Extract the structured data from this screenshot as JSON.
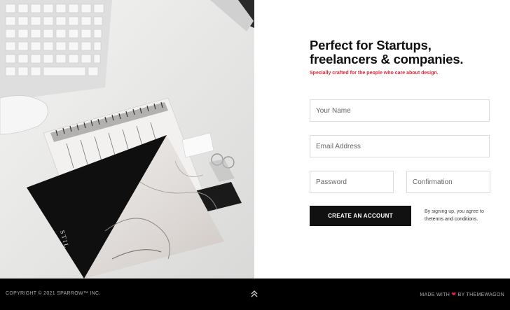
{
  "hero": {
    "title_line1": "Perfect for Startups,",
    "title_line2": "freelancers & companies.",
    "subtitle": "Specially crafted for the people who care about design."
  },
  "form": {
    "name_placeholder": "Your Name",
    "email_placeholder": "Email Address",
    "password_placeholder": "Password",
    "confirmation_placeholder": "Confirmation",
    "submit_label": "CREATE AN ACCOUNT",
    "terms_prefix": "By signing up, you agree to the",
    "terms_link": "terms and conditions."
  },
  "notebook": {
    "brand": "STIL"
  },
  "footer": {
    "copyright": "COPYRIGHT © 2021 SPARROW™ INC.",
    "made_with": "MADE WITH",
    "by": "BY THEMEWAGON",
    "heart_icon": "heart-icon",
    "to_top_icon": "double-chevron-up-icon"
  },
  "colors": {
    "accent": "#e0283a",
    "dark": "#111111",
    "footer_bg": "#000000"
  }
}
